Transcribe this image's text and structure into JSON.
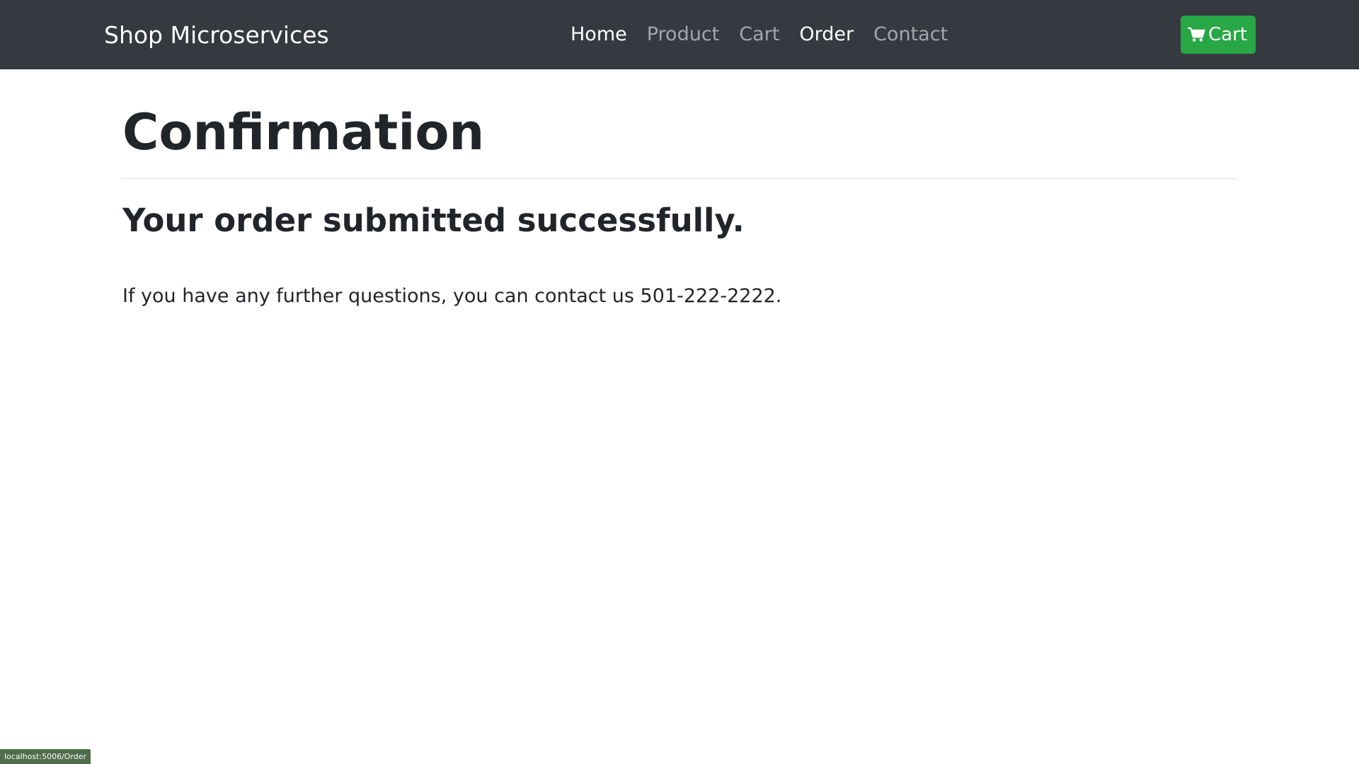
{
  "navbar": {
    "brand": "Shop Microservices",
    "links": [
      {
        "label": "Home",
        "active": true
      },
      {
        "label": "Product",
        "active": false
      },
      {
        "label": "Cart",
        "active": false
      },
      {
        "label": "Order",
        "active": true
      },
      {
        "label": "Contact",
        "active": false
      }
    ],
    "cart_button": {
      "label": "Cart",
      "icon": "shopping-cart-icon"
    }
  },
  "main": {
    "title": "Confirmation",
    "subtitle": "Your order submitted successfully.",
    "message": "If you have any further questions, you can contact us 501-222-2222."
  },
  "status_bar": {
    "url": "localhost:5006/Order"
  },
  "colors": {
    "navbar_bg": "#343a40",
    "cart_button_bg": "#28a745",
    "text": "#212529",
    "status_bar_bg": "#4f6c4b"
  }
}
